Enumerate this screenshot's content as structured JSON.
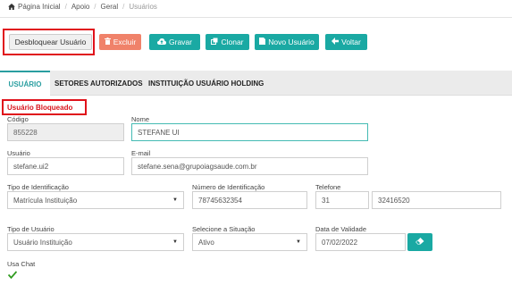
{
  "breadcrumb": {
    "home": "Página Inicial",
    "items": [
      "Apoio",
      "Geral"
    ],
    "current": "Usuários"
  },
  "toolbar": {
    "unlock_label": "Desbloquear Usuário",
    "delete_label": "Excluir",
    "save_label": "Gravar",
    "clone_label": "Clonar",
    "new_label": "Novo Usuário",
    "back_label": "Voltar"
  },
  "tabs": {
    "user": "USUÁRIO",
    "sectors": "SETORES AUTORIZADOS",
    "holding": "INSTITUIÇÃO USUÁRIO HOLDING"
  },
  "status": "Usuário Bloqueado",
  "form": {
    "code": {
      "label": "Código",
      "value": "855228"
    },
    "name": {
      "label": "Nome",
      "value": "STEFANE UI"
    },
    "user": {
      "label": "Usuário",
      "value": "stefane.ui2"
    },
    "email": {
      "label": "E-mail",
      "value": "stefane.sena@grupoiagsaude.com.br"
    },
    "id_type": {
      "label": "Tipo de Identificação",
      "value": "Matrícula Instituição"
    },
    "id_number": {
      "label": "Número de Identificação",
      "value": "78745632354"
    },
    "phone": {
      "label": "Telefone",
      "ddd": "31",
      "number": "32416520"
    },
    "user_type": {
      "label": "Tipo de Usuário",
      "value": "Usuário Instituição"
    },
    "situation": {
      "label": "Selecione a Situação",
      "value": "Ativo"
    },
    "validity": {
      "label": "Data de Validade",
      "value": "07/02/2022"
    },
    "chat": {
      "label": "Usa Chat",
      "checked": true
    }
  },
  "colors": {
    "teal": "#1aa9a3",
    "danger": "#f0826a",
    "highlight": "#e0121b"
  }
}
